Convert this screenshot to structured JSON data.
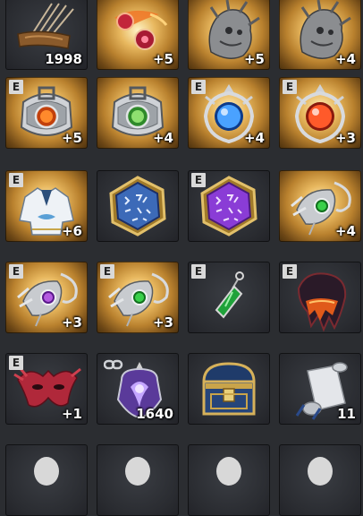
{
  "inventory": {
    "slots": [
      {
        "icon": "arrow-quiver-icon",
        "count": "1998",
        "equip": "",
        "bg": "dark"
      },
      {
        "icon": "fire-gem-fragments-icon",
        "count": "+5",
        "equip": "",
        "bg": "gold"
      },
      {
        "icon": "dragon-figure-icon",
        "count": "+5",
        "equip": "",
        "bg": "gold"
      },
      {
        "icon": "dragon-figure-icon",
        "count": "+4",
        "equip": "",
        "bg": "gold"
      },
      {
        "icon": "bracelet-orange-gem-icon",
        "count": "+5",
        "equip": "E",
        "bg": "gold"
      },
      {
        "icon": "bracelet-green-gem-icon",
        "count": "+4",
        "equip": "",
        "bg": "gold"
      },
      {
        "icon": "amulet-blue-orb-icon",
        "count": "+4",
        "equip": "E",
        "bg": "gold"
      },
      {
        "icon": "amulet-red-orb-icon",
        "count": "+3",
        "equip": "E",
        "bg": "gold"
      },
      {
        "icon": "white-robe-armor-icon",
        "count": "+6",
        "equip": "E",
        "bg": "gold"
      },
      {
        "icon": "rune-stone-blue-icon",
        "count": "",
        "equip": "",
        "bg": "dark"
      },
      {
        "icon": "rune-stone-purple-icon",
        "count": "",
        "equip": "E",
        "bg": "dark"
      },
      {
        "icon": "earring-green-gem-icon",
        "count": "+4",
        "equip": "",
        "bg": "gold"
      },
      {
        "icon": "earring-purple-gem-icon",
        "count": "+3",
        "equip": "E",
        "bg": "gold"
      },
      {
        "icon": "earring-green-gem-icon",
        "count": "+3",
        "equip": "E",
        "bg": "gold"
      },
      {
        "icon": "green-crystal-pendant-icon",
        "count": "",
        "equip": "E",
        "bg": "dark"
      },
      {
        "icon": "molten-cloak-icon",
        "count": "",
        "equip": "E",
        "bg": "dark"
      },
      {
        "icon": "red-mask-icon",
        "count": "+1",
        "equip": "E",
        "bg": "dark"
      },
      {
        "icon": "purple-seal-orb-icon",
        "count": "1640",
        "equip": "",
        "bg": "dark",
        "locked": true
      },
      {
        "icon": "treasure-chest-icon",
        "count": "",
        "equip": "",
        "bg": "dark"
      },
      {
        "icon": "scroll-icon",
        "count": "11",
        "equip": "",
        "bg": "dark"
      },
      {
        "icon": "partial-item-icon",
        "count": "",
        "equip": "",
        "bg": "dark"
      },
      {
        "icon": "partial-item-icon",
        "count": "",
        "equip": "",
        "bg": "dark"
      },
      {
        "icon": "partial-item-icon",
        "count": "",
        "equip": "",
        "bg": "dark"
      },
      {
        "icon": "partial-item-icon",
        "count": "",
        "equip": "",
        "bg": "dark"
      }
    ]
  }
}
